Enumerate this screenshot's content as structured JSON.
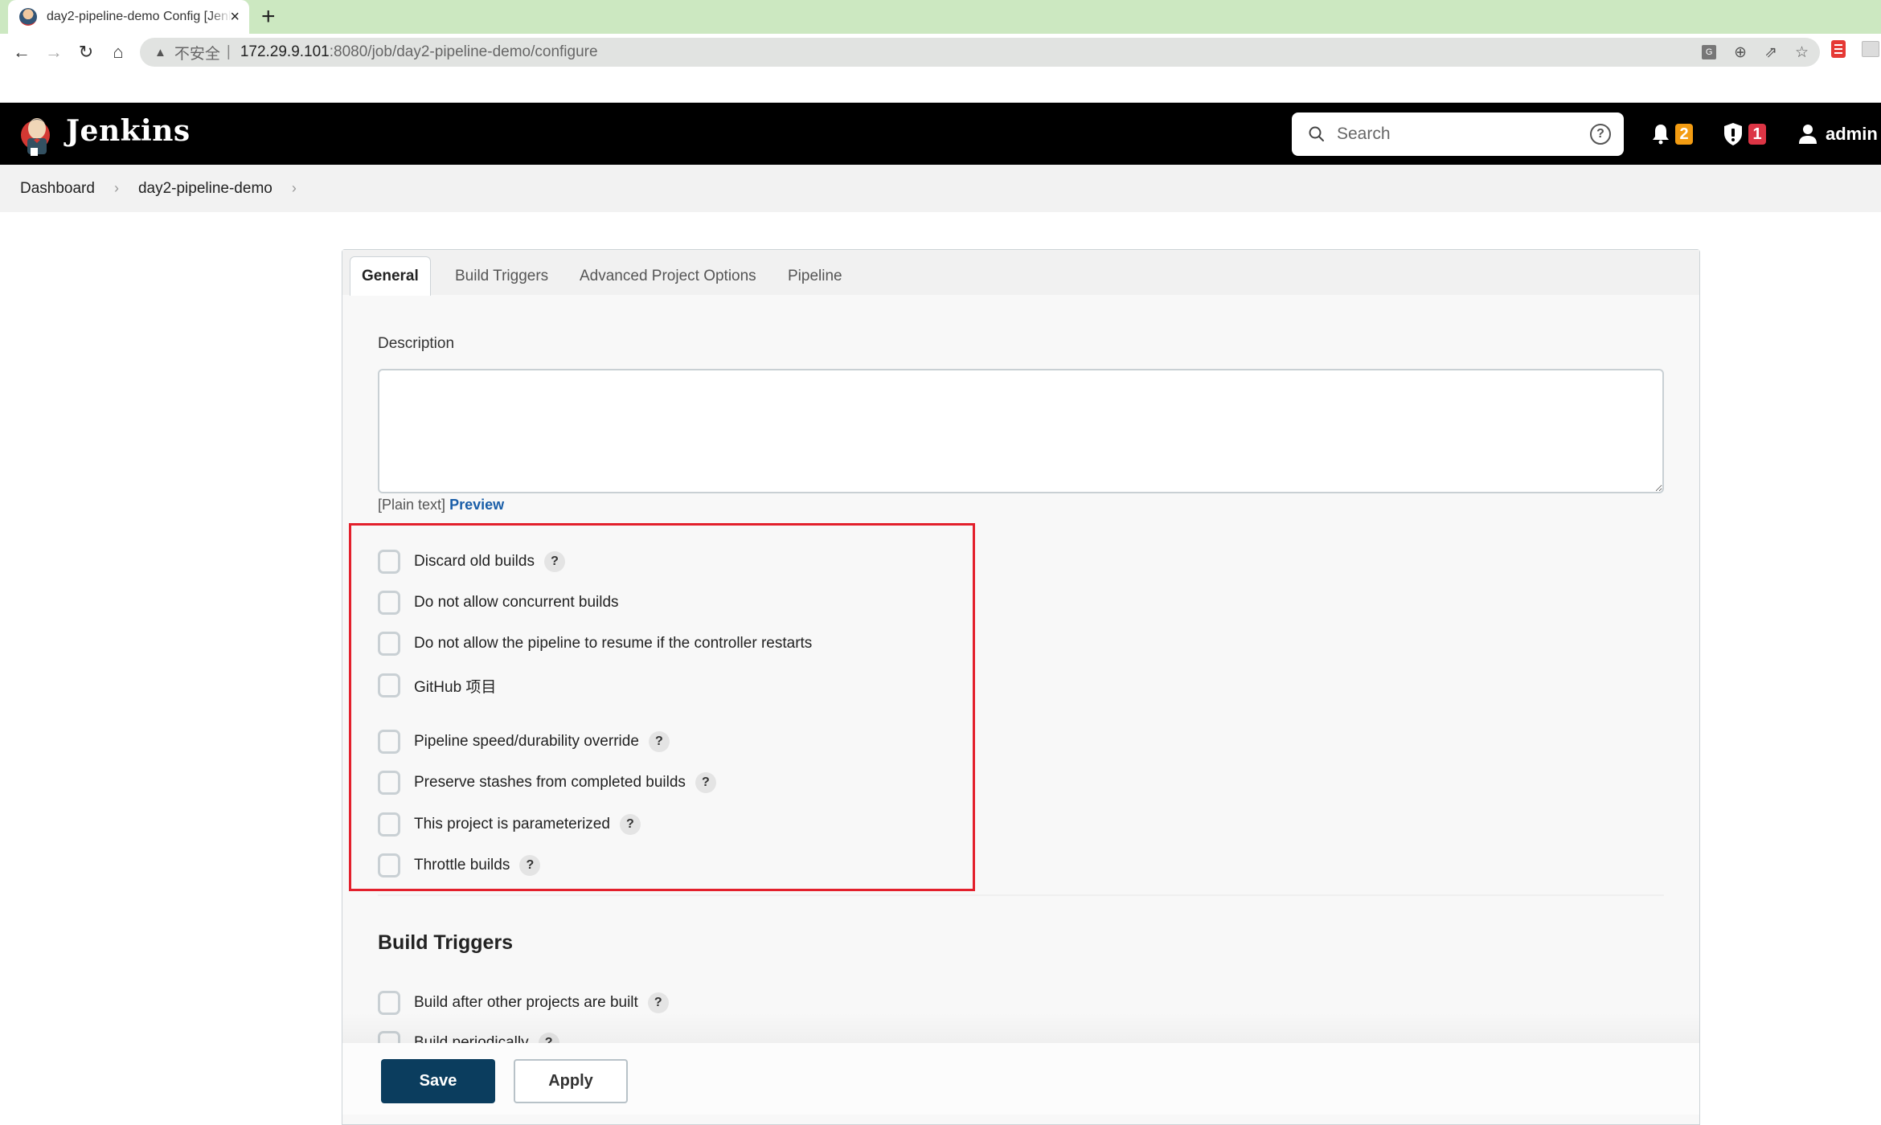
{
  "browser": {
    "tab_title": "day2-pipeline-demo Config [Jenkins]",
    "new_tab_label": "+",
    "close_label": "×",
    "security_label": "不安全",
    "url_host": "172.29.9.101",
    "url_rest": ":8080/job/day2-pipeline-demo/configure"
  },
  "header": {
    "app_name": "Jenkins",
    "search_placeholder": "Search",
    "notifications_count": "2",
    "security_alerts_count": "1",
    "user_name": "admin",
    "colors": {
      "notification_badge": "#f39c12",
      "security_badge": "#dc3545"
    }
  },
  "breadcrumb": {
    "items": [
      "Dashboard",
      "day2-pipeline-demo"
    ]
  },
  "config": {
    "tabs": [
      {
        "label": "General",
        "active": true
      },
      {
        "label": "Build Triggers",
        "active": false
      },
      {
        "label": "Advanced Project Options",
        "active": false
      },
      {
        "label": "Pipeline",
        "active": false
      }
    ],
    "description": {
      "label": "Description",
      "value": "",
      "format_hint": "[Plain text]",
      "preview_label": "Preview"
    },
    "general_options": [
      {
        "label": "Discard old builds",
        "checked": false,
        "help": true
      },
      {
        "label": "Do not allow concurrent builds",
        "checked": false,
        "help": false
      },
      {
        "label": "Do not allow the pipeline to resume if the controller restarts",
        "checked": false,
        "help": false
      },
      {
        "label": "GitHub 项目",
        "checked": false,
        "help": false
      },
      {
        "label": "Pipeline speed/durability override",
        "checked": false,
        "help": true
      },
      {
        "label": "Preserve stashes from completed builds",
        "checked": false,
        "help": true
      },
      {
        "label": "This project is parameterized",
        "checked": false,
        "help": true
      },
      {
        "label": "Throttle builds",
        "checked": false,
        "help": true
      }
    ],
    "build_triggers": {
      "heading": "Build Triggers",
      "options": [
        {
          "label": "Build after other projects are built",
          "checked": false,
          "help": true
        },
        {
          "label": "Build periodically",
          "checked": false,
          "help": true
        }
      ]
    },
    "help_glyph": "?",
    "highlight_color": "#e3202c"
  },
  "actions": {
    "save_label": "Save",
    "apply_label": "Apply",
    "save_color": "#0b3d5e"
  }
}
